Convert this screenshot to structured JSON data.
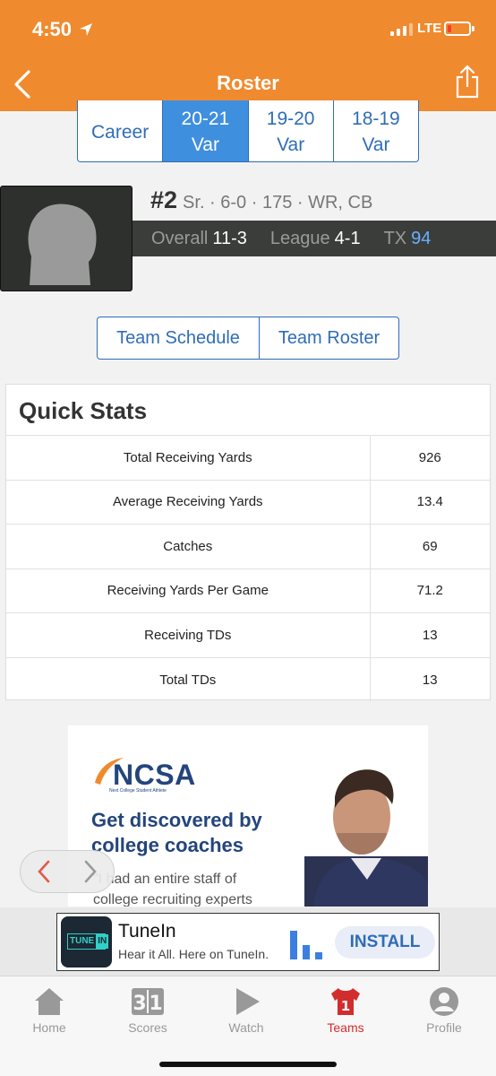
{
  "status_bar": {
    "time": "4:50",
    "network": "LTE"
  },
  "nav": {
    "title": "Roster"
  },
  "season_tabs": [
    {
      "line1": "Career",
      "line2": "",
      "active": false
    },
    {
      "line1": "20-21",
      "line2": "Var",
      "active": true
    },
    {
      "line1": "19-20",
      "line2": "Var",
      "active": false
    },
    {
      "line1": "18-19",
      "line2": "Var",
      "active": false
    }
  ],
  "player": {
    "number": "#2",
    "details": "Sr. · 6-0 · 175 · WR, CB",
    "overall_label": "Overall",
    "overall_value": "11-3",
    "league_label": "League",
    "league_value": "4-1",
    "state_label": "TX",
    "state_rank": "94"
  },
  "team_links": {
    "schedule": "Team Schedule",
    "roster": "Team Roster"
  },
  "quick_stats": {
    "title": "Quick Stats",
    "rows": [
      {
        "label": "Total Receiving Yards",
        "value": "926"
      },
      {
        "label": "Average Receiving Yards",
        "value": "13.4"
      },
      {
        "label": "Catches",
        "value": "69"
      },
      {
        "label": "Receiving Yards Per Game",
        "value": "71.2"
      },
      {
        "label": "Receiving TDs",
        "value": "13"
      },
      {
        "label": "Total TDs",
        "value": "13"
      }
    ]
  },
  "ad": {
    "brand": "NCSA",
    "brand_sub": "Next College Student Athlete",
    "headline_1": "Get discovered by",
    "headline_2": "college coaches",
    "quote_1": "\"I had an entire staff of",
    "quote_2": "college recruiting experts"
  },
  "banner": {
    "icon_text_1": "TUNE",
    "icon_text_2": "IN",
    "name": "TuneIn",
    "tagline": "Hear it All. Here on TuneIn.",
    "cta": "INSTALL"
  },
  "tabbar": [
    {
      "label": "Home",
      "icon": "home-icon"
    },
    {
      "label": "Scores",
      "icon": "scores-icon"
    },
    {
      "label": "Watch",
      "icon": "play-icon"
    },
    {
      "label": "Teams",
      "icon": "jersey-icon",
      "badge": "1"
    },
    {
      "label": "Profile",
      "icon": "profile-icon"
    }
  ],
  "colors": {
    "header": "#f08a2e",
    "link": "#2f6db6",
    "active_tab": "#3f8fdf",
    "teams_red": "#d22d2d"
  }
}
